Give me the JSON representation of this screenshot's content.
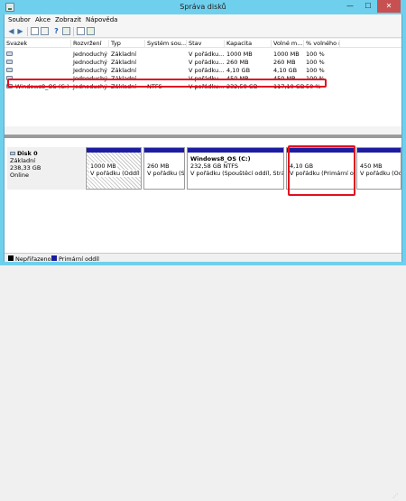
{
  "window": {
    "title": "Správa disků",
    "min_glyph": "—",
    "max_glyph": "☐",
    "close_glyph": "✕"
  },
  "menu": [
    "Soubor",
    "Akce",
    "Zobrazit",
    "Nápověda"
  ],
  "toolbar": {
    "icons": [
      "back-icon",
      "forward-icon",
      "properties-icon",
      "view-icon",
      "help-icon",
      "rescan-icon",
      "checklist-icon",
      "refresh-icon"
    ]
  },
  "volumes": {
    "columns": [
      "Svazek",
      "Rozvržení",
      "Typ",
      "Systém sou...",
      "Stav",
      "Kapacita",
      "Volné m...",
      "% volného m..."
    ],
    "rows": [
      [
        "",
        "Jednoduchý",
        "Základní",
        "",
        "V pořádku...",
        "1000 MB",
        "1000 MB",
        "100 %"
      ],
      [
        "",
        "Jednoduchý",
        "Základní",
        "",
        "V pořádku...",
        "260 MB",
        "260 MB",
        "100 %"
      ],
      [
        "",
        "Jednoduchý",
        "Základní",
        "",
        "V pořádku...",
        "4,10 GB",
        "4,10 GB",
        "100 %"
      ],
      [
        "",
        "Jednoduchý",
        "Základní",
        "",
        "V pořádku...",
        "450 MB",
        "450 MB",
        "100 %"
      ],
      [
        "Windows8_OS (C:)",
        "Jednoduchý",
        "Základní",
        "NTFS",
        "V pořádku...",
        "232,58 GB",
        "117,10 GB",
        "50 %"
      ]
    ]
  },
  "disk": {
    "name": "Disk 0",
    "type": "Základní",
    "size": "238,33 GB",
    "status": "Online",
    "partitions": [
      {
        "label": "",
        "size": "1000 MB",
        "status": "V pořádku (Oddíl p"
      },
      {
        "label": "",
        "size": "260 MB",
        "status": "V pořádku (S"
      },
      {
        "label": "Windows8_OS (C:)",
        "size": "232,58 GB NTFS",
        "status": "V pořádku (Spouštěcí oddíl, Stránko"
      },
      {
        "label": "",
        "size": "4,10 GB",
        "status": "V pořádku (Primární od"
      },
      {
        "label": "",
        "size": "450 MB",
        "status": "V pořádku (Odd"
      }
    ]
  },
  "legend": [
    {
      "label": "Nepřiřazeno",
      "color": "#000000"
    },
    {
      "label": "Primární oddíl",
      "color": "#1c1ca0"
    }
  ],
  "colors": {
    "accent_frame": "#6fd0ed",
    "primary_partition": "#1c1ca0",
    "annotation": "#e01020",
    "close_button": "#c75050"
  }
}
